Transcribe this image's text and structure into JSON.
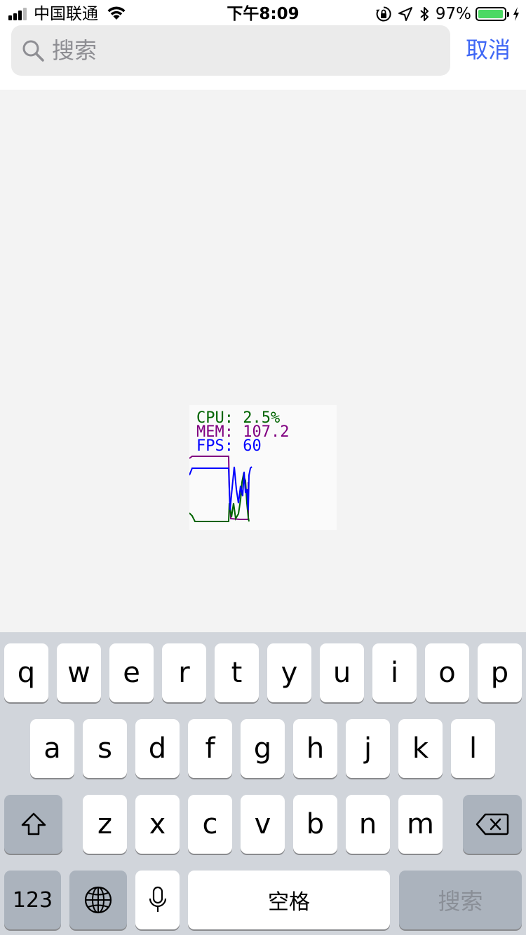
{
  "status_bar": {
    "carrier": "中国联通",
    "time": "下午8:09",
    "battery_percent": "97%",
    "battery_level": 0.97,
    "icons": [
      "signal-icon",
      "wifi-icon",
      "orientation-lock-icon",
      "location-icon",
      "bluetooth-icon",
      "battery-icon",
      "charging-icon"
    ]
  },
  "search": {
    "placeholder": "搜索",
    "value": "",
    "cancel_label": "取消",
    "accent_color": "#3f67f5"
  },
  "monitor": {
    "cpu": "CPU: 2.5%",
    "mem": "MEM: 107.2",
    "fps": "FPS: 60",
    "colors": {
      "cpu": "#006400",
      "mem": "#800080",
      "fps": "#0000ff"
    }
  },
  "keyboard": {
    "row1": [
      "q",
      "w",
      "e",
      "r",
      "t",
      "y",
      "u",
      "i",
      "o",
      "p"
    ],
    "row2": [
      "a",
      "s",
      "d",
      "f",
      "g",
      "h",
      "j",
      "k",
      "l"
    ],
    "row3": [
      "z",
      "x",
      "c",
      "v",
      "b",
      "n",
      "m"
    ],
    "numbers_label": "123",
    "space_label": "空格",
    "search_label": "搜索"
  }
}
